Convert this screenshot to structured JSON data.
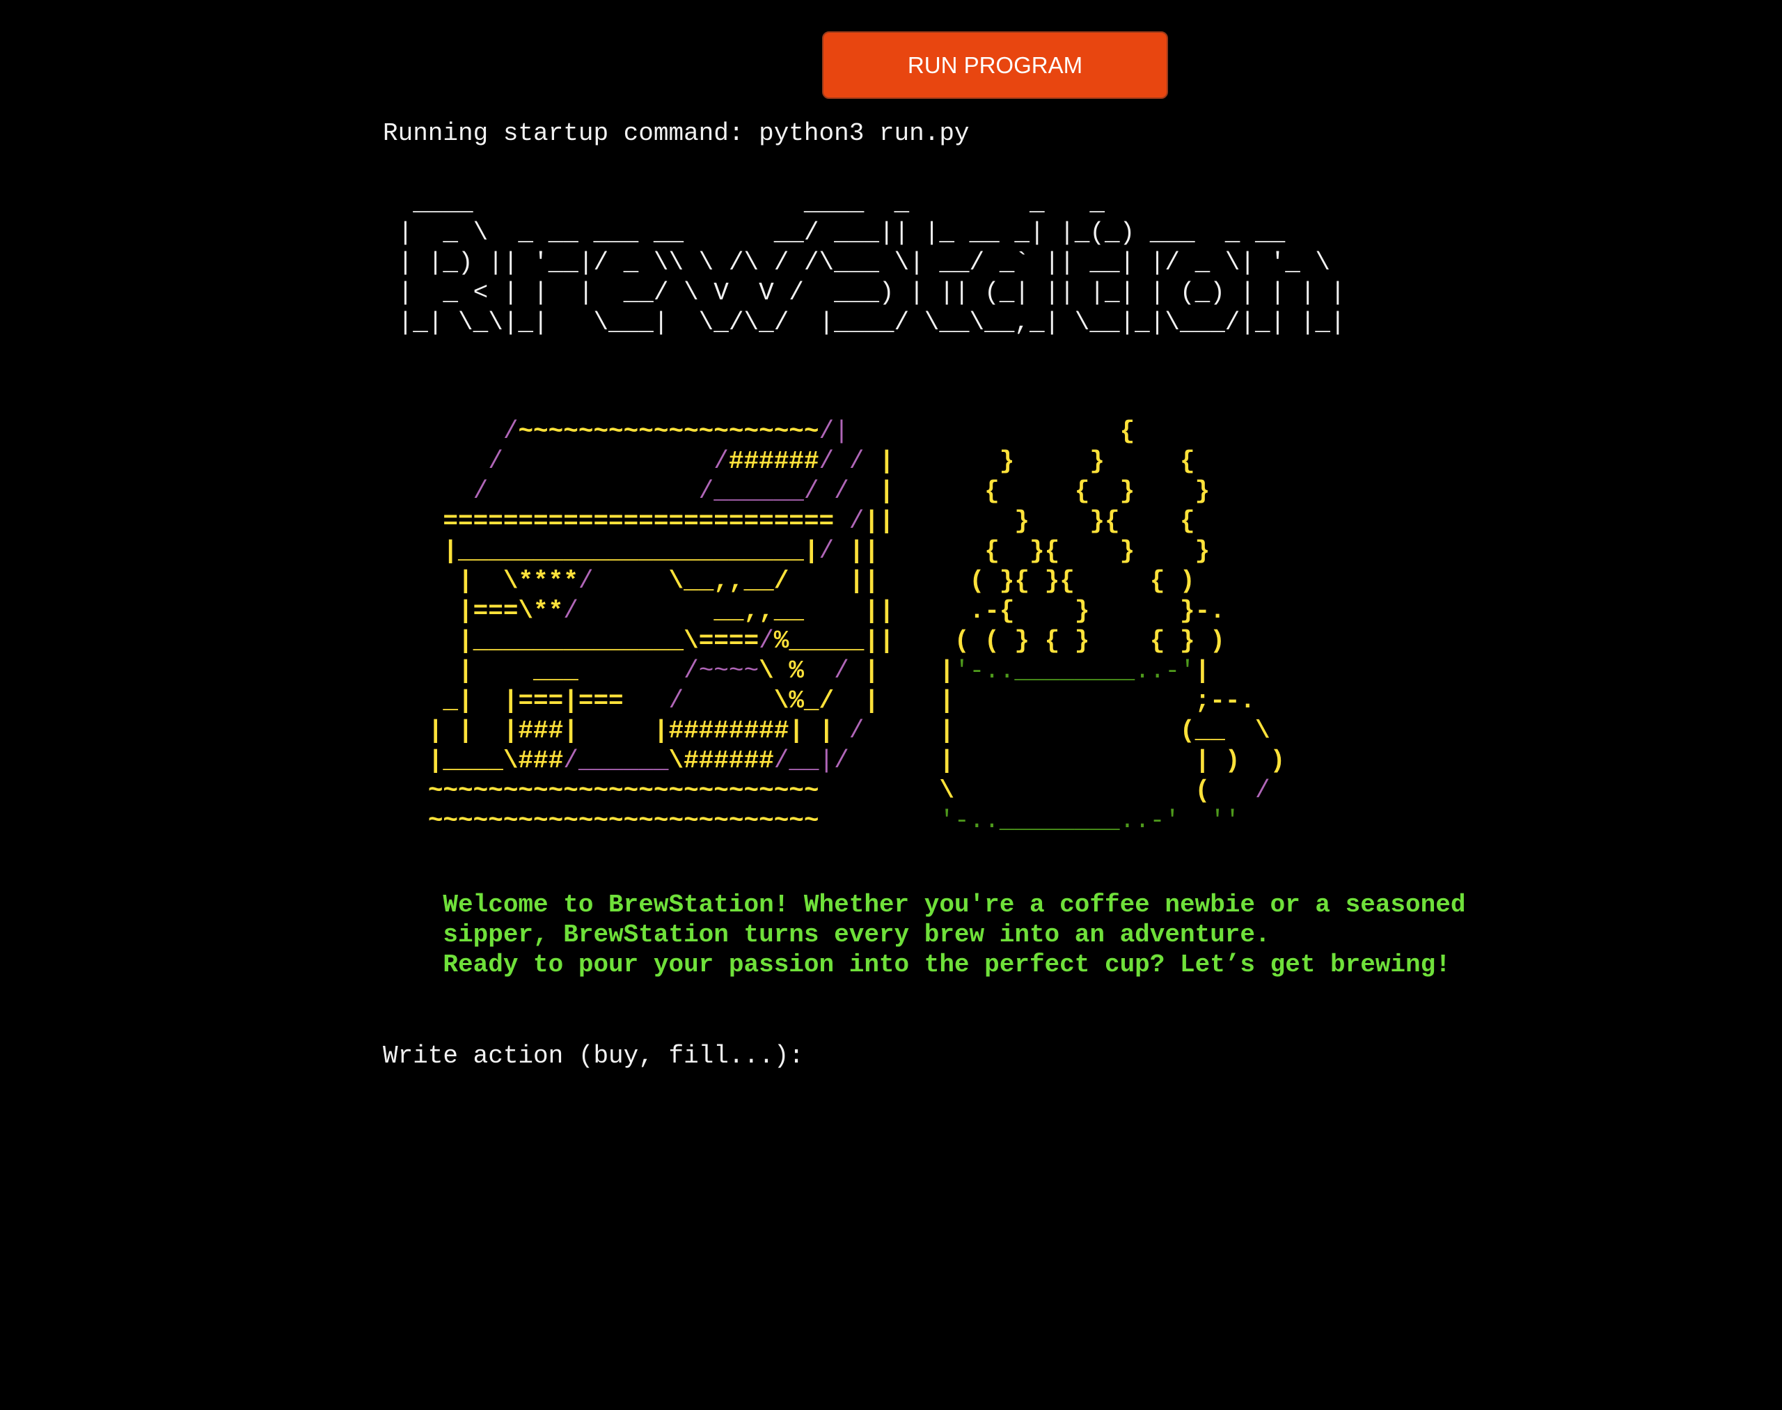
{
  "toolbar": {
    "run_label": "RUN PROGRAM"
  },
  "terminal": {
    "startup_line": "Running startup command: python3 run.py",
    "logo_ascii": "  ____                      ____  _        _   _             \n |  _ \\  _ __ ___ __      __/ ___|| |_ __ _| |_(_) ___  _ __  \n | |_) || '__|/ _ \\\\ \\ /\\ / /\\___ \\| __/ _` || __| |/ _ \\| '_ \\ \n |  _ < | |  |  __/ \\ V  V /  ___) | || (_| || |_| | (_) | | | |\n |_| \\_\\|_|   \\___|  \\_/\\_/  |____/ \\__\\__,_| \\__|_|\\___/|_| |_|",
    "welcome_lines": [
      "    Welcome to BrewStation! Whether you're a coffee newbie or a seasoned",
      "    sipper, BrewStation turns every brew into an adventure.",
      "    Ready to pour your passion into the perfect cup? Let’s get brewing!"
    ],
    "prompt_label": "Write action (buy, fill...):",
    "prompt_value": ""
  },
  "colors": {
    "background": "#000000",
    "button": "#e84610",
    "terminal_text": "#f2f2f2",
    "art_yellow": "#ffe23a",
    "art_purple": "#b066b8",
    "art_green": "#4e9a1c",
    "welcome_green": "#6fe03a"
  }
}
